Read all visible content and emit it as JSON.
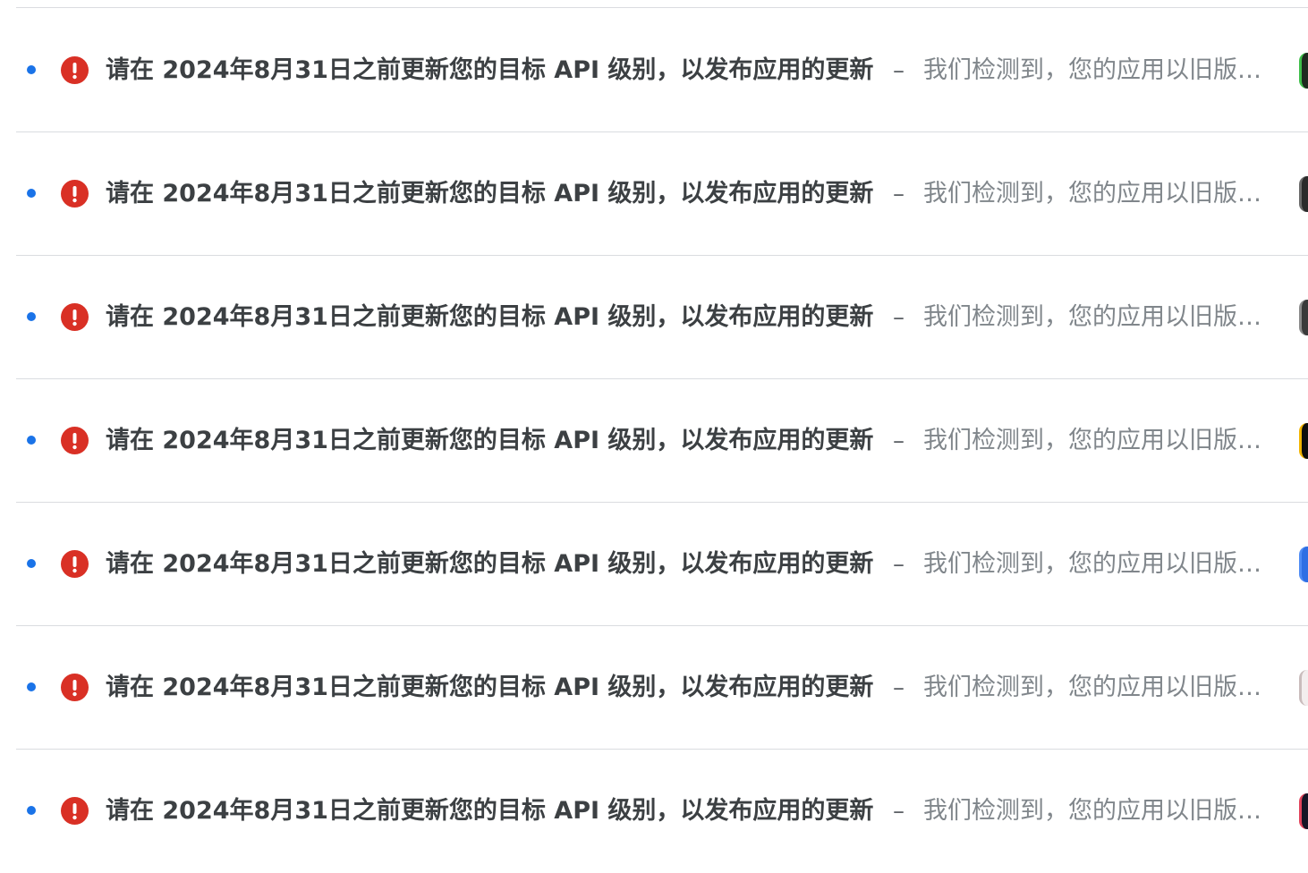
{
  "rows": [
    {
      "subject": "请在 2024年8月31日之前更新您的目标 API 级别，以发布应用的更新",
      "separator": "–",
      "snippet": "我们检测到，您的应用以旧版本...",
      "thumb_color": "#1f2a1f",
      "thumb_accent": "#3fbf4a"
    },
    {
      "subject": "请在 2024年8月31日之前更新您的目标 API 级别，以发布应用的更新",
      "separator": "–",
      "snippet": "我们检测到，您的应用以旧版本...",
      "thumb_color": "#2b2b2b",
      "thumb_accent": "#6b6b6b"
    },
    {
      "subject": "请在 2024年8月31日之前更新您的目标 API 级别，以发布应用的更新",
      "separator": "–",
      "snippet": "我们检测到，您的应用以旧版本...",
      "thumb_color": "#3a3a3a",
      "thumb_accent": "#8a8a8a"
    },
    {
      "subject": "请在 2024年8月31日之前更新您的目标 API 级别，以发布应用的更新",
      "separator": "–",
      "snippet": "我们检测到，您的应用以旧版本...",
      "thumb_color": "#0d0d0d",
      "thumb_accent": "#f2b400"
    },
    {
      "subject": "请在 2024年8月31日之前更新您的目标 API 级别，以发布应用的更新",
      "separator": "–",
      "snippet": "我们检测到，您的应用以旧版本...",
      "thumb_color": "#2f6fe4",
      "thumb_accent": "#4f8cf5"
    },
    {
      "subject": "请在 2024年8月31日之前更新您的目标 API 级别，以发布应用的更新",
      "separator": "–",
      "snippet": "我们检测到，您的应用以旧版本...",
      "thumb_color": "#f3eeee",
      "thumb_accent": "#c9bcbc"
    },
    {
      "subject": "请在 2024年8月31日之前更新您的目标 API 级别，以发布应用的更新",
      "separator": "–",
      "snippet": "我们检测到，您的应用以旧版本...",
      "thumb_color": "#151526",
      "thumb_accent": "#e2445c"
    }
  ],
  "colors": {
    "unread_dot": "#1a73e8",
    "alert_icon": "#d93025",
    "subject_text": "#3c4043",
    "snippet_text": "#80868b",
    "divider": "#dadce0"
  },
  "icons": {
    "unread": "unread-dot-icon",
    "alert": "error-alert-icon"
  }
}
